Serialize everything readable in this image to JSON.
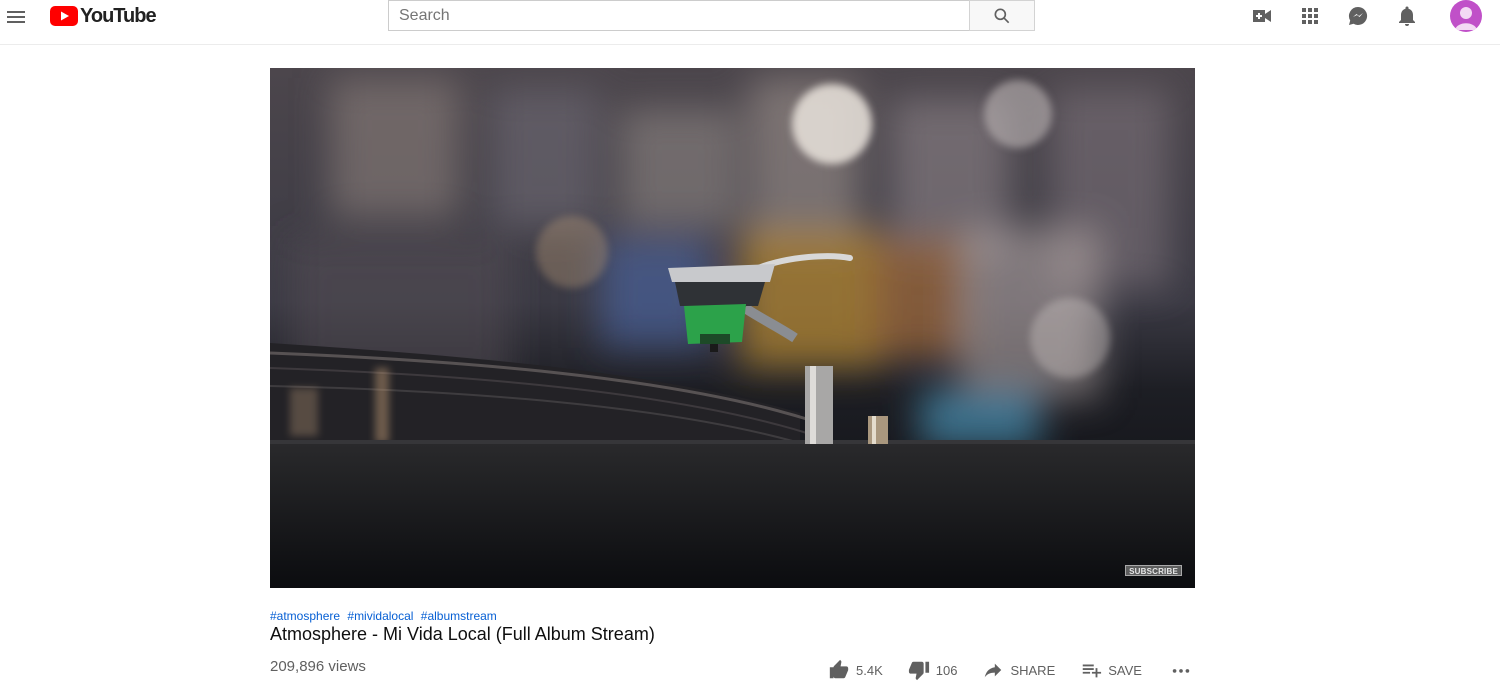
{
  "masthead": {
    "logo_text": "YouTube",
    "search_placeholder": "Search",
    "search_value": "",
    "icons": [
      "menu-icon",
      "youtube-logo-icon",
      "search-icon",
      "create-video-icon",
      "apps-icon",
      "messages-icon",
      "notifications-icon",
      "avatar"
    ]
  },
  "player": {
    "watermark": "SUBSCRIBE"
  },
  "video": {
    "hashtags": [
      "#atmosphere",
      "#mividalocal",
      "#albumstream"
    ],
    "title": "Atmosphere - Mi Vida Local (Full Album Stream)",
    "views": "209,896 views",
    "likes": "5.4K",
    "dislikes": "106",
    "share_label": "SHARE",
    "save_label": "SAVE"
  },
  "colors": {
    "brand_red": "#ff0000",
    "link_blue": "#065fd4",
    "text_secondary": "#606060",
    "avatar_purple": "#c050c8"
  }
}
